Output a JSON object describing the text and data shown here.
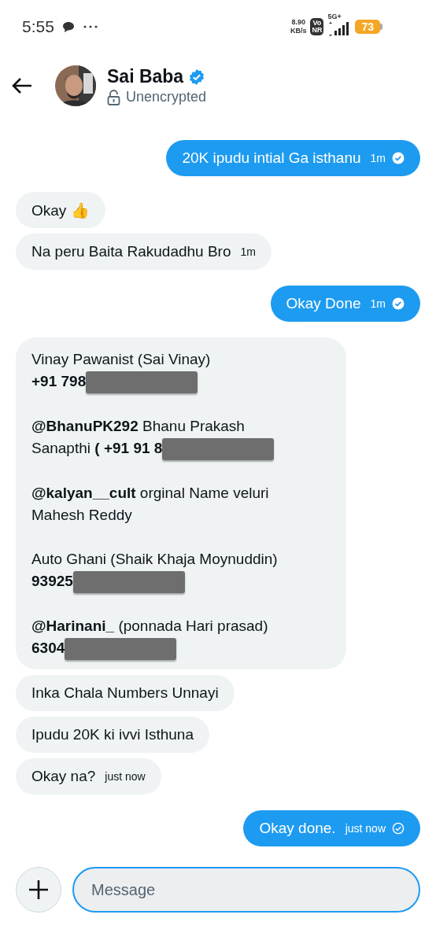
{
  "status_bar": {
    "time": "5:55",
    "net_speed": "8.90",
    "net_unit": "KB/s",
    "volte": [
      "Vo",
      "NR"
    ],
    "network": "5G+",
    "battery": "73"
  },
  "header": {
    "name": "Sai Baba",
    "verified": true,
    "encryption": "Unencrypted"
  },
  "messages": [
    {
      "outgoing": true,
      "text": "20K ipudu intial Ga isthanu",
      "time": "1m",
      "read": true
    },
    {
      "outgoing": false,
      "text": "Okay 👍"
    },
    {
      "outgoing": false,
      "text": "Na peru Baita Rakudadhu Bro",
      "time": "1m"
    },
    {
      "outgoing": true,
      "text": "Okay Done",
      "time": "1m",
      "read": true
    },
    {
      "outgoing": false,
      "paragraphs": [
        {
          "lines": [
            "Vinay Pawanist (Sai Vinay)",
            "**+91 798**"
          ],
          "redacted": true
        },
        {
          "lines": [
            "**@BhanuPK292** Bhanu Prakash",
            "Sanapthi **( +91 91 8**"
          ],
          "redacted": true
        },
        {
          "lines": [
            "**@kalyan__cult**  orginal Name veluri",
            "Mahesh Reddy"
          ],
          "redacted": false
        },
        {
          "lines": [
            "Auto Ghani (Shaik Khaja Moynuddin)",
            "**93925**"
          ],
          "redacted": true
        },
        {
          "lines": [
            "**@Harinani_** (ponnada Hari prasad)",
            "**6304**"
          ],
          "redacted": true
        }
      ]
    },
    {
      "outgoing": false,
      "text": "Inka Chala Numbers Unnayi"
    },
    {
      "outgoing": false,
      "text": "Ipudu 20K ki ivvi Isthuna"
    },
    {
      "outgoing": false,
      "text": "Okay na?",
      "time": "just now"
    },
    {
      "outgoing": true,
      "text": "Okay done.",
      "time": "just now",
      "read": false
    }
  ],
  "composer": {
    "placeholder": "Message"
  }
}
